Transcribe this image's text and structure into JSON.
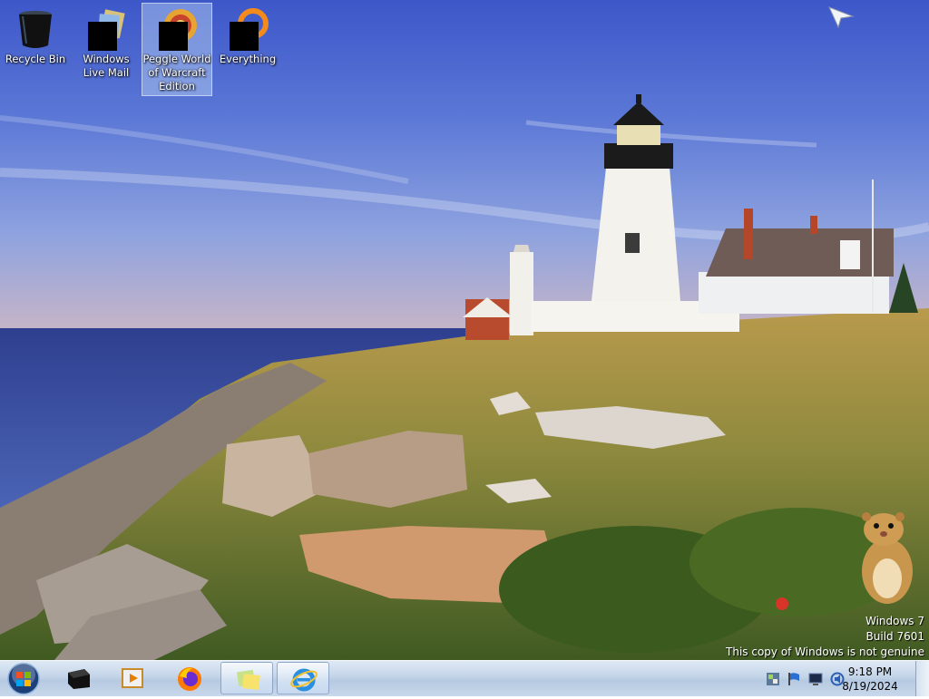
{
  "desktop": {
    "icons": [
      {
        "label": "Recycle Bin",
        "icon": "recycle-bin-icon"
      },
      {
        "label": "Windows Live Mail",
        "icon": "windows-live-mail-icon"
      },
      {
        "label": "Peggle World of Warcraft Edition",
        "icon": "peggle-icon"
      },
      {
        "label": "Everything",
        "icon": "everything-icon"
      }
    ],
    "watermark": {
      "line1": "Windows 7",
      "line2": "Build 7601",
      "line3": "This copy of Windows is not genuine"
    }
  },
  "taskbar": {
    "start_icon": "windows-orb-icon",
    "pinned": [
      {
        "icon": "black-app-icon"
      },
      {
        "icon": "media-player-icon"
      },
      {
        "icon": "firefox-icon"
      },
      {
        "icon": "sticky-notes-icon"
      },
      {
        "icon": "internet-explorer-icon"
      }
    ],
    "tray_icons": [
      "network-icon",
      "flag-icon",
      "monitor-icon",
      "volume-icon"
    ],
    "clock": {
      "time": "9:18 PM",
      "date": "8/19/2024"
    }
  }
}
